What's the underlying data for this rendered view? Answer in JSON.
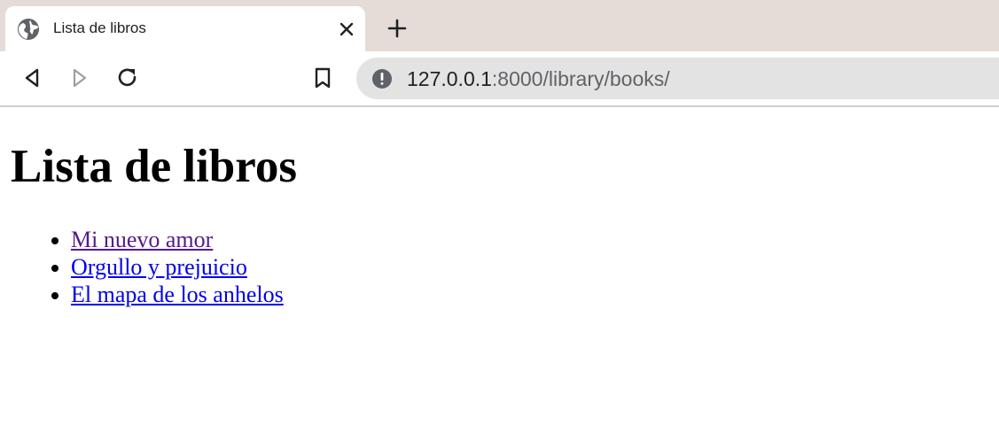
{
  "browser": {
    "tab": {
      "title": "Lista de libros",
      "favicon": "globe-icon"
    },
    "new_tab_icon": "plus-icon",
    "toolbar": {
      "back_icon": "back-icon",
      "forward_icon": "forward-icon",
      "reload_icon": "reload-icon",
      "bookmark_icon": "bookmark-icon",
      "address": {
        "host": "127.0.0.1",
        "rest": ":8000/library/books/",
        "info_icon": "info-icon"
      }
    },
    "colors": {
      "tabstrip_bg": "#e5dcd8",
      "omnibox_bg": "#e3e3e3",
      "link_visited": "#551a8b",
      "link_unvisited": "#0000ee"
    }
  },
  "page": {
    "heading": "Lista de libros",
    "books": [
      {
        "title": "Mi nuevo amor",
        "visited": true
      },
      {
        "title": "Orgullo y prejuicio",
        "visited": false
      },
      {
        "title": "El mapa de los anhelos",
        "visited": false
      }
    ]
  }
}
